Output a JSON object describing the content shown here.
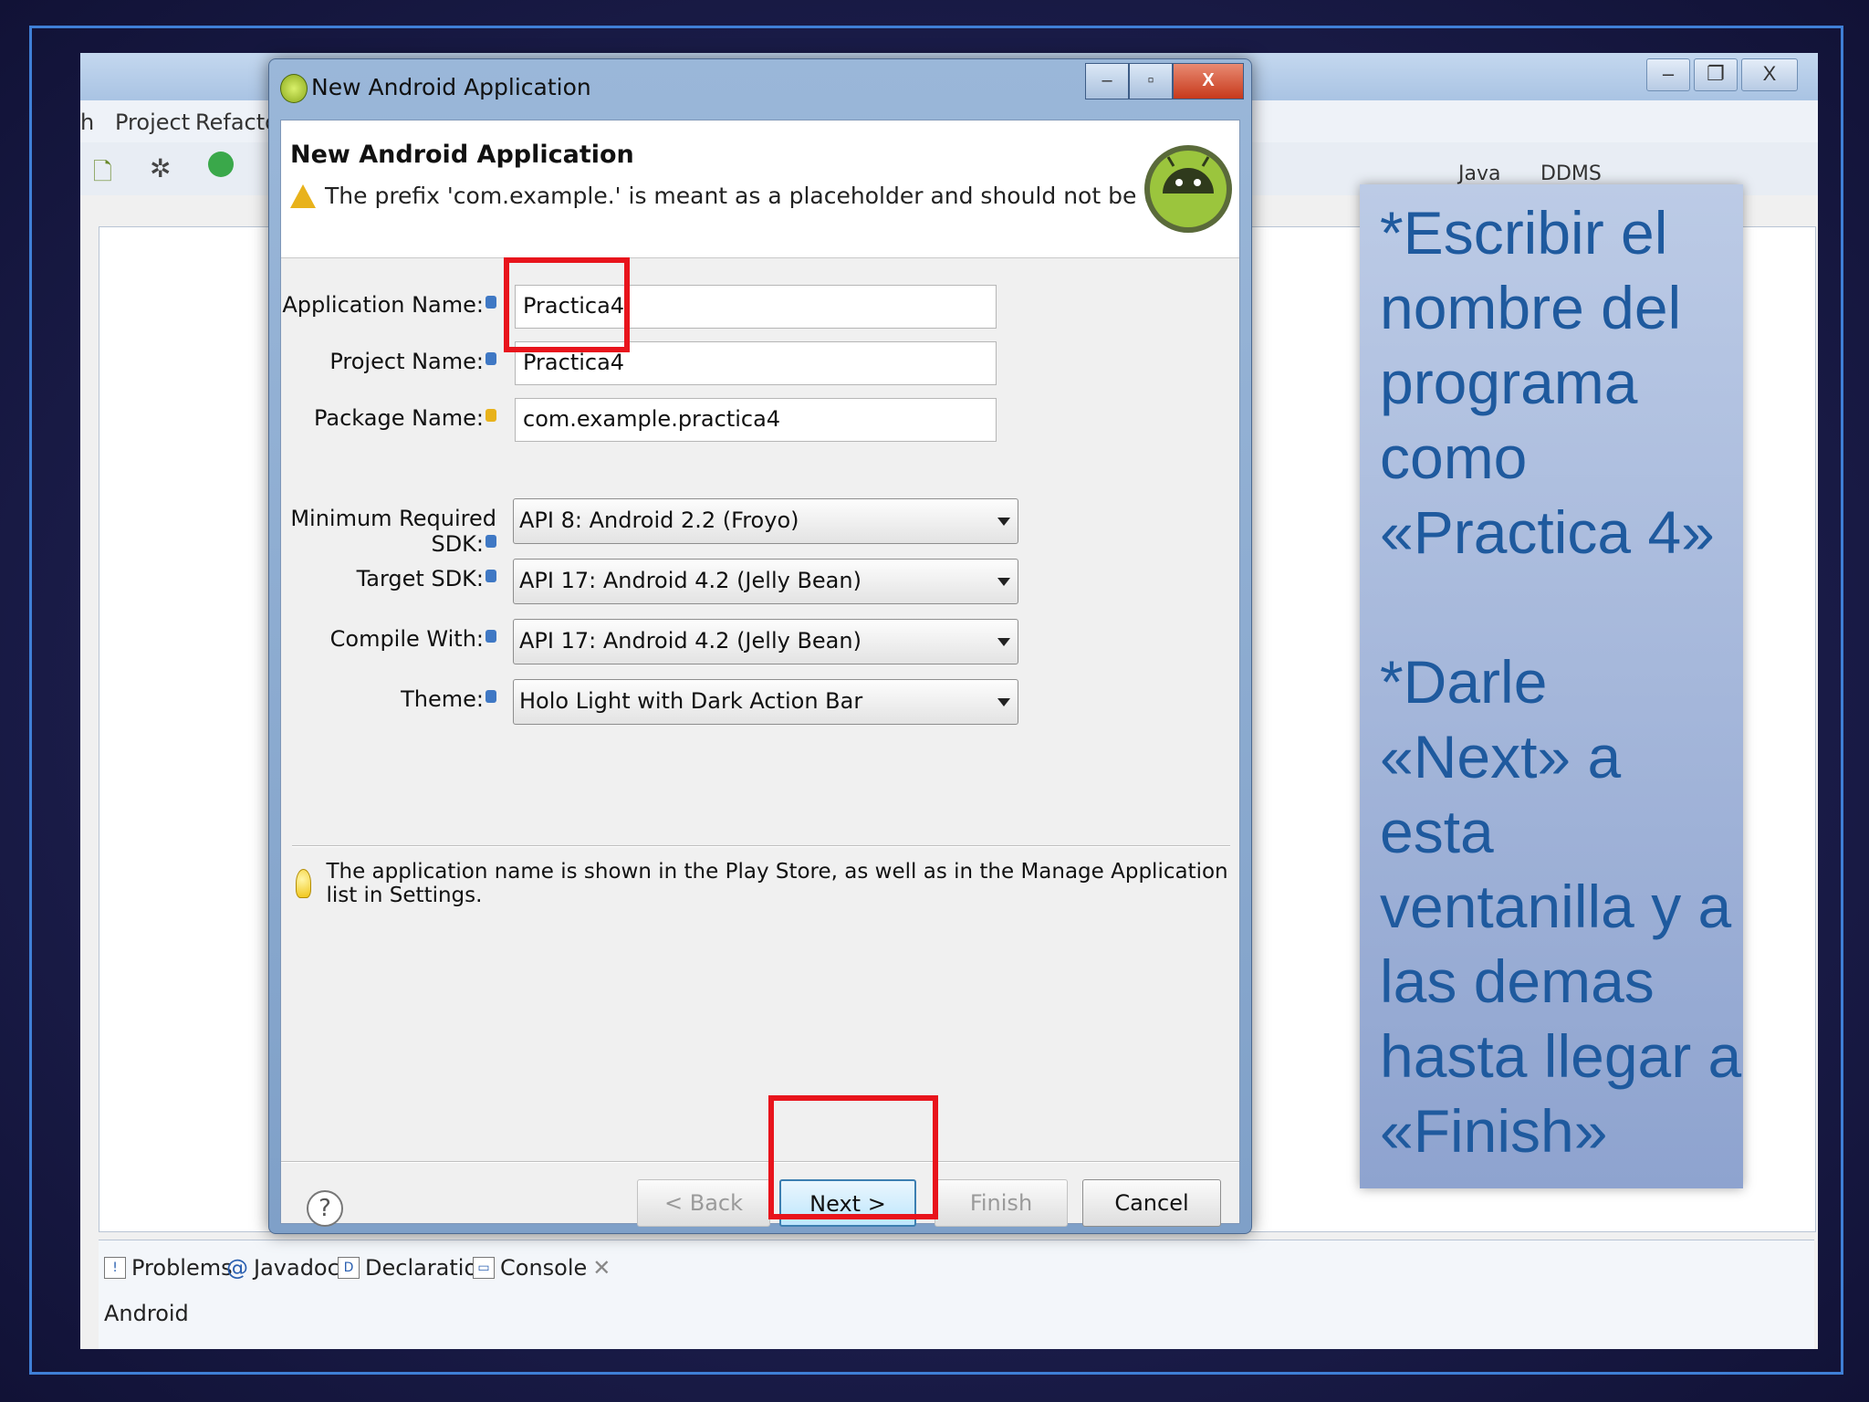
{
  "eclipse": {
    "menu": [
      "h",
      "Project",
      "Refactor"
    ],
    "window_buttons": {
      "minimize": "‒",
      "restore": "❐",
      "close": "X"
    },
    "perspectives": [
      "Java",
      "DDMS"
    ],
    "bottom_tabs": [
      "Problems",
      "Javadoc",
      "Declaration",
      "Console"
    ],
    "console_label": "Android"
  },
  "dialog": {
    "window_title": "New Android Application",
    "header_title": "New Android Application",
    "warning": "The prefix 'com.example.' is meant as a placeholder and should not be used",
    "fields": {
      "application_name": {
        "label": "Application Name:",
        "value": "Practica4"
      },
      "project_name": {
        "label": "Project Name:",
        "value": "Practica4"
      },
      "package_name": {
        "label": "Package Name:",
        "value": "com.example.practica4"
      }
    },
    "selects": {
      "min_sdk": {
        "label": "Minimum Required SDK:",
        "value": "API 8: Android 2.2 (Froyo)"
      },
      "target_sdk": {
        "label": "Target SDK:",
        "value": "API 17: Android 4.2 (Jelly Bean)"
      },
      "compile_with": {
        "label": "Compile With:",
        "value": "API 17: Android 4.2 (Jelly Bean)"
      },
      "theme": {
        "label": "Theme:",
        "value": "Holo Light with Dark Action Bar"
      }
    },
    "hint": "The application name is shown in the Play Store, as well as in the Manage Application list in Settings.",
    "buttons": {
      "help": "?",
      "back": "< Back",
      "next": "Next >",
      "finish": "Finish",
      "cancel": "Cancel"
    }
  },
  "note": {
    "text": "*Escribir el nombre del programa como «Practica 4»\n\n*Darle «Next» a esta ventanilla y a las demas hasta llegar a «Finish»"
  },
  "colors": {
    "highlight": "#e8141c",
    "note_text": "#1f5a9e",
    "frame": "#3f7fd6"
  }
}
